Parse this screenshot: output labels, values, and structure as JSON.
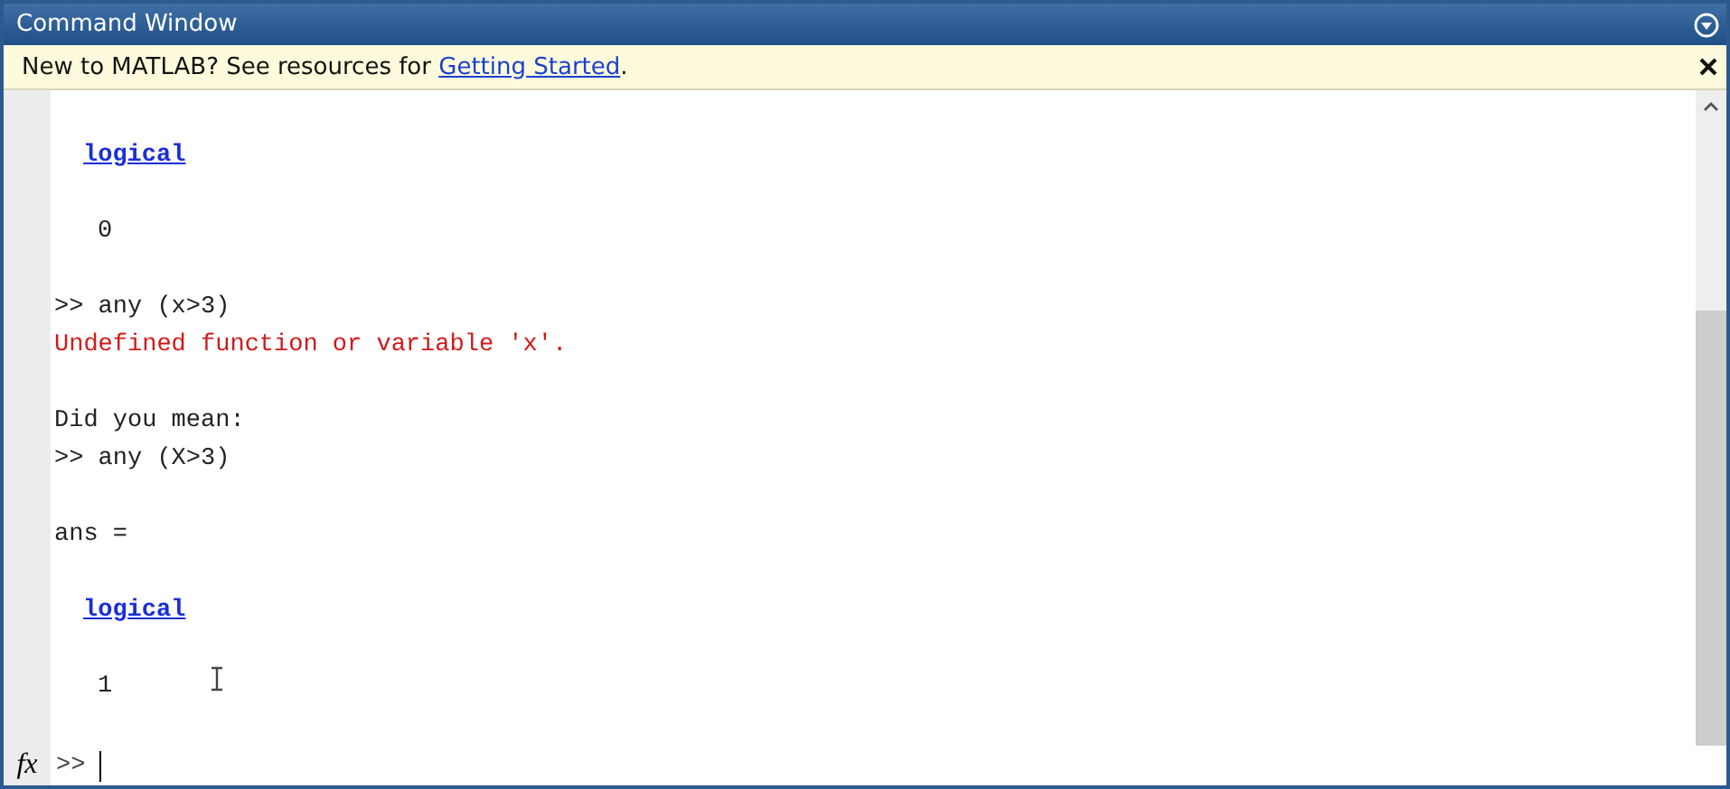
{
  "window": {
    "title": "Command Window"
  },
  "banner": {
    "text": "New to MATLAB? See resources for ",
    "link": "Getting Started",
    "after": "."
  },
  "lines": [
    {
      "kind": "blank"
    },
    {
      "kind": "link",
      "text": "logical"
    },
    {
      "kind": "blank"
    },
    {
      "kind": "value",
      "text": "0"
    },
    {
      "kind": "blank"
    },
    {
      "kind": "command",
      "text": ">> any (x>3)"
    },
    {
      "kind": "error",
      "text": "Undefined function or variable 'x'."
    },
    {
      "kind": "blank"
    },
    {
      "kind": "output",
      "text": "Did you mean:"
    },
    {
      "kind": "command",
      "text": ">> any (X>3)"
    },
    {
      "kind": "blank"
    },
    {
      "kind": "output",
      "text": "ans ="
    },
    {
      "kind": "blank"
    },
    {
      "kind": "link",
      "text": "logical"
    },
    {
      "kind": "blank"
    },
    {
      "kind": "value",
      "text": "1"
    }
  ],
  "prompt": {
    "fx": "fx",
    "symbol": ">>"
  }
}
